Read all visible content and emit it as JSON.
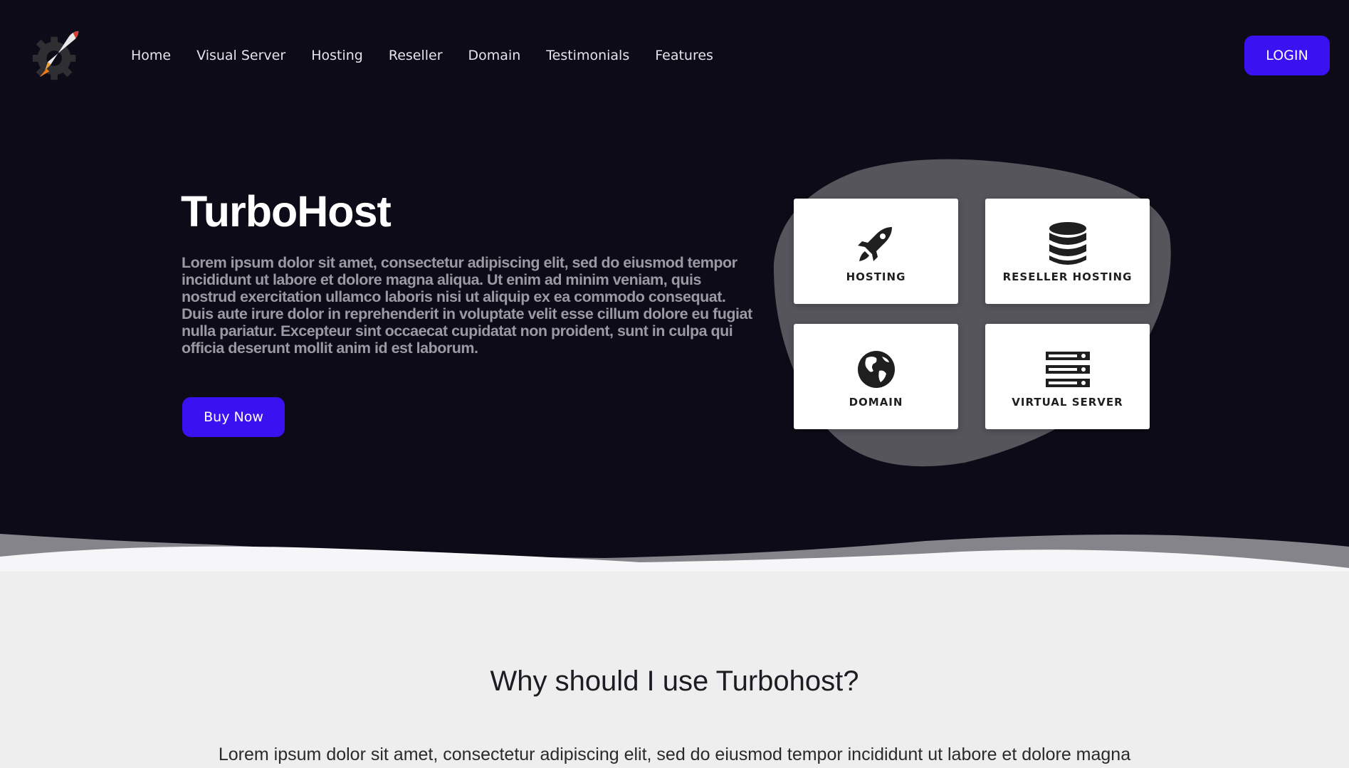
{
  "brand": {
    "logo_icon": "rocket-gear-logo"
  },
  "nav": {
    "items": [
      {
        "label": "Home"
      },
      {
        "label": "Visual Server"
      },
      {
        "label": "Hosting"
      },
      {
        "label": "Reseller"
      },
      {
        "label": "Domain"
      },
      {
        "label": "Testimonials"
      },
      {
        "label": "Features"
      }
    ],
    "login_label": "LOGIN"
  },
  "hero": {
    "title": "TurboHost",
    "description": "Lorem ipsum dolor sit amet, consectetur adipiscing elit, sed do eiusmod tempor incididunt ut labore et dolore magna aliqua. Ut enim ad minim veniam, quis nostrud exercitation ullamco laboris nisi ut aliquip ex ea commodo consequat. Duis aute irure dolor in reprehenderit in voluptate velit esse cillum dolore eu fugiat nulla pariatur. Excepteur sint occaecat cupidatat non proident, sunt in culpa qui officia deserunt mollit anim id est laborum.",
    "buy_label": "Buy Now"
  },
  "services": [
    {
      "label": "HOSTING",
      "icon": "rocket-icon"
    },
    {
      "label": "RESELLER HOSTING",
      "icon": "database-icon"
    },
    {
      "label": "DOMAIN",
      "icon": "globe-icon"
    },
    {
      "label": "VIRTUAL SERVER",
      "icon": "server-icon"
    }
  ],
  "why": {
    "title": "Why should I use Turbohost?",
    "description": "Lorem ipsum dolor sit amet, consectetur adipiscing elit, sed do eiusmod tempor incididunt ut labore et dolore magna"
  },
  "colors": {
    "accent": "#3a12f2",
    "hero_bg": "#0d0b17",
    "blob": "#56555c",
    "section_bg": "#eeeeee"
  }
}
